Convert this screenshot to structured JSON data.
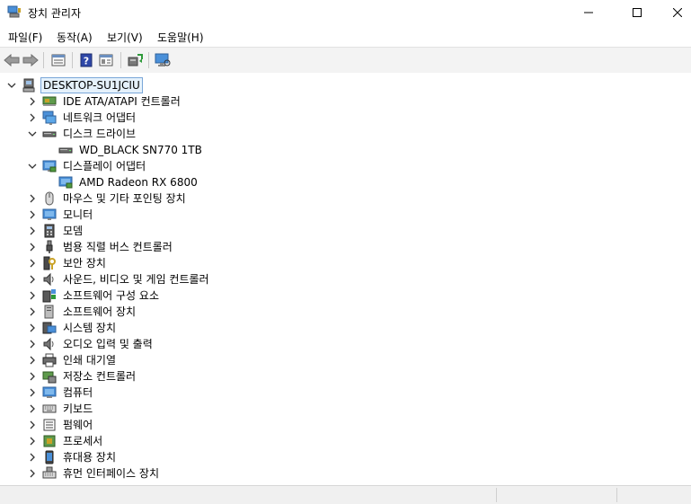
{
  "window": {
    "title": "장치 관리자"
  },
  "menu": [
    {
      "label": "파일(F)"
    },
    {
      "label": "동작(A)"
    },
    {
      "label": "보기(V)"
    },
    {
      "label": "도움말(H)"
    }
  ],
  "toolbar": {
    "icons": [
      "back-icon",
      "forward-icon",
      "properties-icon",
      "help-icon",
      "view-icon",
      "update-driver-icon",
      "monitor-scan-icon"
    ]
  },
  "tree": {
    "root": {
      "label": "DESKTOP-SU1JCIU",
      "expanded": true
    },
    "items": [
      {
        "label": "IDE ATA/ATAPI 컨트롤러",
        "icon": "ide-controller-icon",
        "level": 1,
        "expand": "collapsed"
      },
      {
        "label": "네트워크 어댑터",
        "icon": "network-adapter-icon",
        "level": 1,
        "expand": "collapsed"
      },
      {
        "label": "디스크 드라이브",
        "icon": "disk-drive-icon",
        "level": 1,
        "expand": "expanded"
      },
      {
        "label": "WD_BLACK SN770 1TB",
        "icon": "disk-icon",
        "level": 2,
        "expand": "none"
      },
      {
        "label": "디스플레이 어댑터",
        "icon": "display-adapter-icon",
        "level": 1,
        "expand": "expanded"
      },
      {
        "label": "AMD Radeon RX 6800",
        "icon": "gpu-icon",
        "level": 2,
        "expand": "none"
      },
      {
        "label": "마우스 및 기타 포인팅 장치",
        "icon": "mouse-icon",
        "level": 1,
        "expand": "collapsed"
      },
      {
        "label": "모니터",
        "icon": "monitor-icon",
        "level": 1,
        "expand": "collapsed"
      },
      {
        "label": "모뎀",
        "icon": "modem-icon",
        "level": 1,
        "expand": "collapsed"
      },
      {
        "label": "범용 직렬 버스 컨트롤러",
        "icon": "usb-icon",
        "level": 1,
        "expand": "collapsed"
      },
      {
        "label": "보안 장치",
        "icon": "security-key-icon",
        "level": 1,
        "expand": "collapsed"
      },
      {
        "label": "사운드, 비디오 및 게임 컨트롤러",
        "icon": "sound-icon",
        "level": 1,
        "expand": "collapsed"
      },
      {
        "label": "소프트웨어 구성 요소",
        "icon": "software-component-icon",
        "level": 1,
        "expand": "collapsed"
      },
      {
        "label": "소프트웨어 장치",
        "icon": "software-device-icon",
        "level": 1,
        "expand": "collapsed"
      },
      {
        "label": "시스템 장치",
        "icon": "system-device-icon",
        "level": 1,
        "expand": "collapsed"
      },
      {
        "label": "오디오 입력 및 출력",
        "icon": "audio-io-icon",
        "level": 1,
        "expand": "collapsed"
      },
      {
        "label": "인쇄 대기열",
        "icon": "printer-icon",
        "level": 1,
        "expand": "collapsed"
      },
      {
        "label": "저장소 컨트롤러",
        "icon": "storage-controller-icon",
        "level": 1,
        "expand": "collapsed"
      },
      {
        "label": "컴퓨터",
        "icon": "computer-icon",
        "level": 1,
        "expand": "collapsed"
      },
      {
        "label": "키보드",
        "icon": "keyboard-icon",
        "level": 1,
        "expand": "collapsed"
      },
      {
        "label": "펌웨어",
        "icon": "firmware-icon",
        "level": 1,
        "expand": "collapsed"
      },
      {
        "label": "프로세서",
        "icon": "processor-icon",
        "level": 1,
        "expand": "collapsed"
      },
      {
        "label": "휴대용 장치",
        "icon": "portable-device-icon",
        "level": 1,
        "expand": "collapsed"
      },
      {
        "label": "휴먼 인터페이스 장치",
        "icon": "hid-icon",
        "level": 1,
        "expand": "collapsed"
      }
    ]
  },
  "colors": {
    "selection_bg": "#e5f1fb",
    "selection_border": "#7aa7d9",
    "toolbar_bg": "#f3f3f3"
  }
}
